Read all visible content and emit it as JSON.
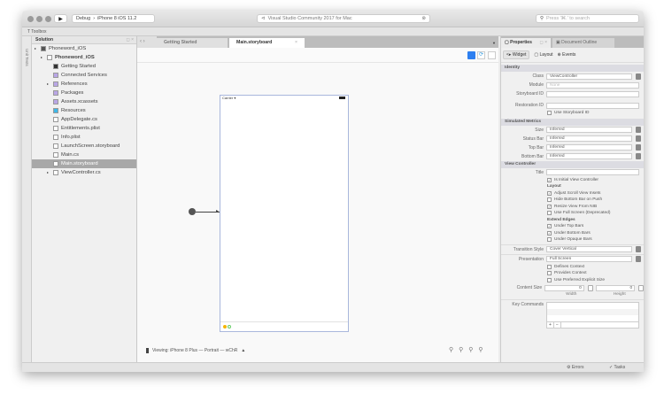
{
  "titlebar": {
    "config": "Debug",
    "device": "iPhone 8 iOS 11.2",
    "app_title": "Visual Studio Community 2017 for Mac",
    "search_placeholder": "Press '⌘.' to search"
  },
  "toolbox": {
    "label": "Toolbox"
  },
  "strip": {
    "label": "Unit Tests"
  },
  "solution": {
    "title": "Solution",
    "items": [
      {
        "label": "Phoneword_iOS",
        "level": 0,
        "expander": true,
        "icon": "solution-icon"
      },
      {
        "label": "Phoneword_iOS",
        "level": 1,
        "expander": true,
        "icon": "project-icon",
        "bold": true
      },
      {
        "label": "Getting Started",
        "level": 2,
        "icon": "rocket-icon"
      },
      {
        "label": "Connected Services",
        "level": 2,
        "icon": "folder-icon"
      },
      {
        "label": "References",
        "level": 2,
        "expander": true,
        "icon": "folder-icon"
      },
      {
        "label": "Packages",
        "level": 2,
        "icon": "folder-icon"
      },
      {
        "label": "Assets.xcassets",
        "level": 2,
        "icon": "folder-icon"
      },
      {
        "label": "Resources",
        "level": 2,
        "icon": "blue-folder-icon"
      },
      {
        "label": "AppDelegate.cs",
        "level": 2,
        "icon": "file-icon"
      },
      {
        "label": "Entitlements.plist",
        "level": 2,
        "icon": "file-icon"
      },
      {
        "label": "Info.plist",
        "level": 2,
        "icon": "file-icon"
      },
      {
        "label": "LaunchScreen.storyboard",
        "level": 2,
        "icon": "file-icon"
      },
      {
        "label": "Main.cs",
        "level": 2,
        "icon": "file-icon"
      },
      {
        "label": "Main.storyboard",
        "level": 2,
        "icon": "file-icon",
        "selected": true
      },
      {
        "label": "ViewController.cs",
        "level": 2,
        "expander": true,
        "icon": "file-icon"
      }
    ]
  },
  "editor": {
    "tabs": [
      {
        "label": "Getting Started"
      },
      {
        "label": "Main.storyboard",
        "active": true
      }
    ],
    "carrier": "Carrier",
    "viewing": "Viewing: iPhone 8 Plus — Portrait — wChR"
  },
  "properties": {
    "tabs": [
      "Properties",
      "Document Outline"
    ],
    "subtabs": [
      "Widget",
      "Layout",
      "Events"
    ],
    "identity": {
      "title": "Identity",
      "class_label": "Class",
      "class_value": "ViewController",
      "module_label": "Module",
      "module_placeholder": "None",
      "storyboard_id_label": "Storyboard ID",
      "restoration_id_label": "Restoration ID",
      "use_storyboard_id": "Use Storyboard ID"
    },
    "simulated": {
      "title": "Simulated Metrics",
      "rows": [
        {
          "label": "Size",
          "value": "Inferred"
        },
        {
          "label": "Status Bar",
          "value": "Inferred"
        },
        {
          "label": "Top Bar",
          "value": "Inferred"
        },
        {
          "label": "Bottom Bar",
          "value": "Inferred"
        }
      ]
    },
    "vc": {
      "title": "View Controller",
      "title_label": "Title",
      "initial": "Is Initial View Controller",
      "layout_title": "Layout",
      "layout_opts": [
        {
          "label": "Adjust Scroll View Insets",
          "checked": true
        },
        {
          "label": "Hide Bottom Bar on Push",
          "checked": false
        },
        {
          "label": "Resize View From NIB",
          "checked": true
        },
        {
          "label": "Use Full Screen (Deprecated)",
          "checked": false
        }
      ],
      "extend_title": "Extend Edges",
      "extend_opts": [
        {
          "label": "Under Top Bars",
          "checked": true
        },
        {
          "label": "Under Bottom Bars",
          "checked": true
        },
        {
          "label": "Under Opaque Bars",
          "checked": false
        }
      ],
      "transition_label": "Transition Style",
      "transition_value": "Cover Vertical",
      "presentation_label": "Presentation",
      "presentation_value": "Full Screen",
      "pres_opts": [
        {
          "label": "Defines Context",
          "checked": false
        },
        {
          "label": "Provides Context",
          "checked": false
        },
        {
          "label": "Use Preferred Explicit Size",
          "checked": false
        }
      ],
      "content_size_label": "Content Size",
      "width_value": "0",
      "height_value": "0",
      "width_label": "Width",
      "height_label": "Height",
      "key_commands_label": "Key Commands",
      "add": "+",
      "remove": "−"
    }
  },
  "statusbar": {
    "errors": "Errors",
    "tasks": "Tasks"
  }
}
